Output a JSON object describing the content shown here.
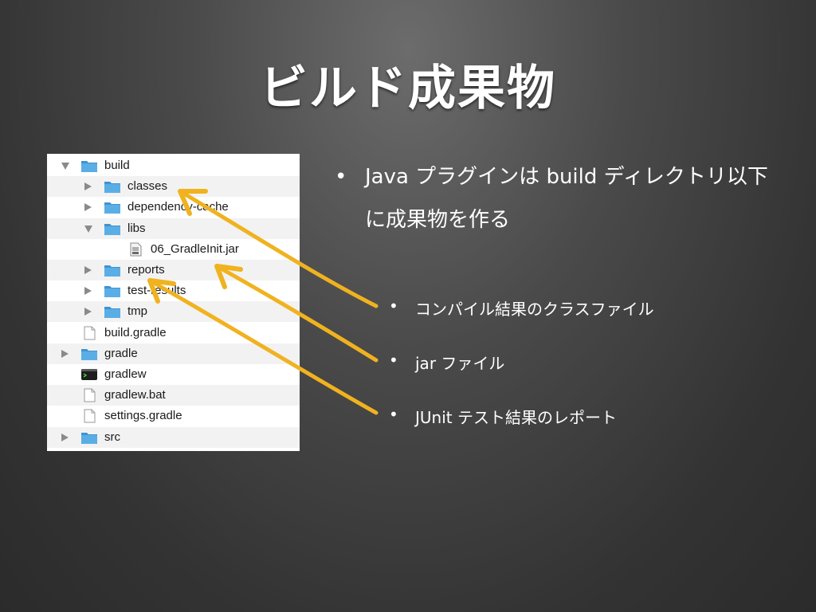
{
  "title": "ビルド成果物",
  "tree": [
    {
      "label": "build",
      "type": "folder",
      "disclosure": "open",
      "indent": 0
    },
    {
      "label": "classes",
      "type": "folder",
      "disclosure": "closed",
      "indent": 1
    },
    {
      "label": "dependency-cache",
      "type": "folder",
      "disclosure": "closed",
      "indent": 1
    },
    {
      "label": "libs",
      "type": "folder",
      "disclosure": "open",
      "indent": 1
    },
    {
      "label": "06_GradleInit.jar",
      "type": "jar",
      "disclosure": "none",
      "indent": 2
    },
    {
      "label": "reports",
      "type": "folder",
      "disclosure": "closed",
      "indent": 1
    },
    {
      "label": "test-results",
      "type": "folder",
      "disclosure": "closed",
      "indent": 1
    },
    {
      "label": "tmp",
      "type": "folder",
      "disclosure": "closed",
      "indent": 1
    },
    {
      "label": "build.gradle",
      "type": "file",
      "disclosure": "none",
      "indent": 0
    },
    {
      "label": "gradle",
      "type": "folder",
      "disclosure": "closed",
      "indent": 0
    },
    {
      "label": "gradlew",
      "type": "exec",
      "disclosure": "none",
      "indent": 0
    },
    {
      "label": "gradlew.bat",
      "type": "file",
      "disclosure": "none",
      "indent": 0
    },
    {
      "label": "settings.gradle",
      "type": "file",
      "disclosure": "none",
      "indent": 0
    },
    {
      "label": "src",
      "type": "folder",
      "disclosure": "closed",
      "indent": 0
    }
  ],
  "bullet_main": "Java プラグインは build ディレクトリ以下に成果物を作る",
  "bullet_symbol": "•",
  "sub_bullets": [
    "コンパイル結果のクラスファイル",
    "jar ファイル",
    "JUnit テスト結果のレポート"
  ],
  "colors": {
    "arrow": "#f0b21f",
    "folder": "#5aaee6",
    "folder_tab": "#3f93d0"
  }
}
